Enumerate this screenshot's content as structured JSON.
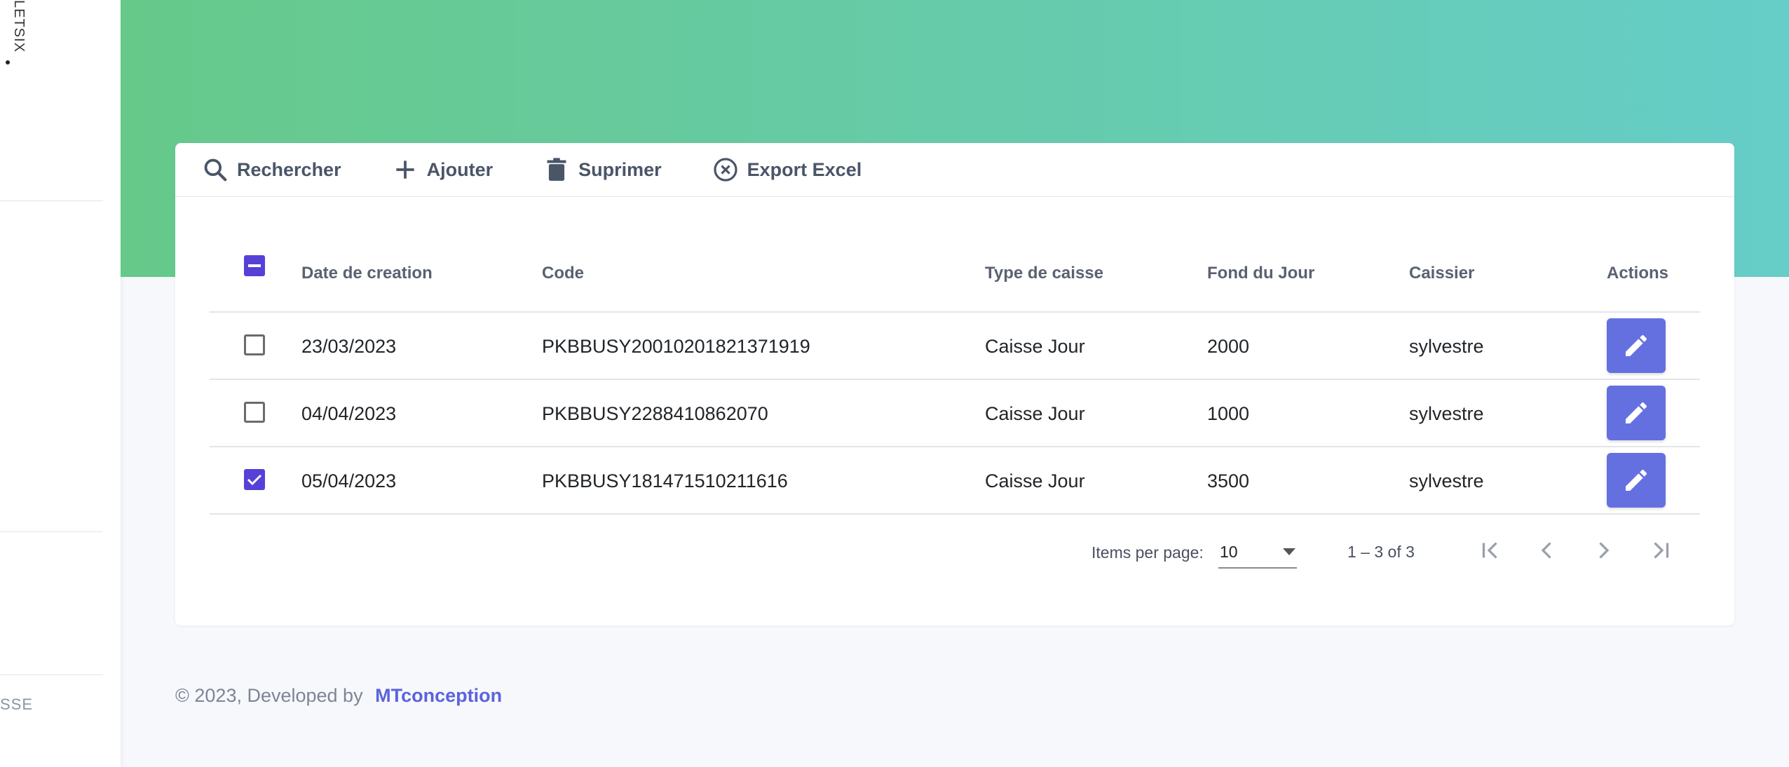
{
  "sidebar": {
    "brand": "LETSIX",
    "bottom_label": "SSE"
  },
  "toolbar": {
    "search_label": "Rechercher",
    "add_label": "Ajouter",
    "delete_label": "Suprimer",
    "export_label": "Export Excel"
  },
  "table": {
    "headers": {
      "date": "Date de creation",
      "code": "Code",
      "type": "Type de caisse",
      "fond": "Fond du Jour",
      "caissier": "Caissier",
      "actions": "Actions"
    },
    "rows": [
      {
        "date": "23/03/2023",
        "code": "PKBBUSY20010201821371919",
        "type": "Caisse Jour",
        "fond": "2000",
        "caissier": "sylvestre",
        "checked": false
      },
      {
        "date": "04/04/2023",
        "code": "PKBBUSY2288410862070",
        "type": "Caisse Jour",
        "fond": "1000",
        "caissier": "sylvestre",
        "checked": false
      },
      {
        "date": "05/04/2023",
        "code": "PKBBUSY181471510211616",
        "type": "Caisse Jour",
        "fond": "3500",
        "caissier": "sylvestre",
        "checked": true
      }
    ]
  },
  "paginator": {
    "items_per_page_label": "Items per page:",
    "page_size": "10",
    "range": "1 – 3 of 3"
  },
  "footer": {
    "text": "© 2023, Developed by",
    "brand": "MTconception"
  },
  "colors": {
    "accent": "#5541d8",
    "edit_button": "#6570e0",
    "gradient_start": "#66c98a",
    "gradient_end": "#66cdc8"
  }
}
